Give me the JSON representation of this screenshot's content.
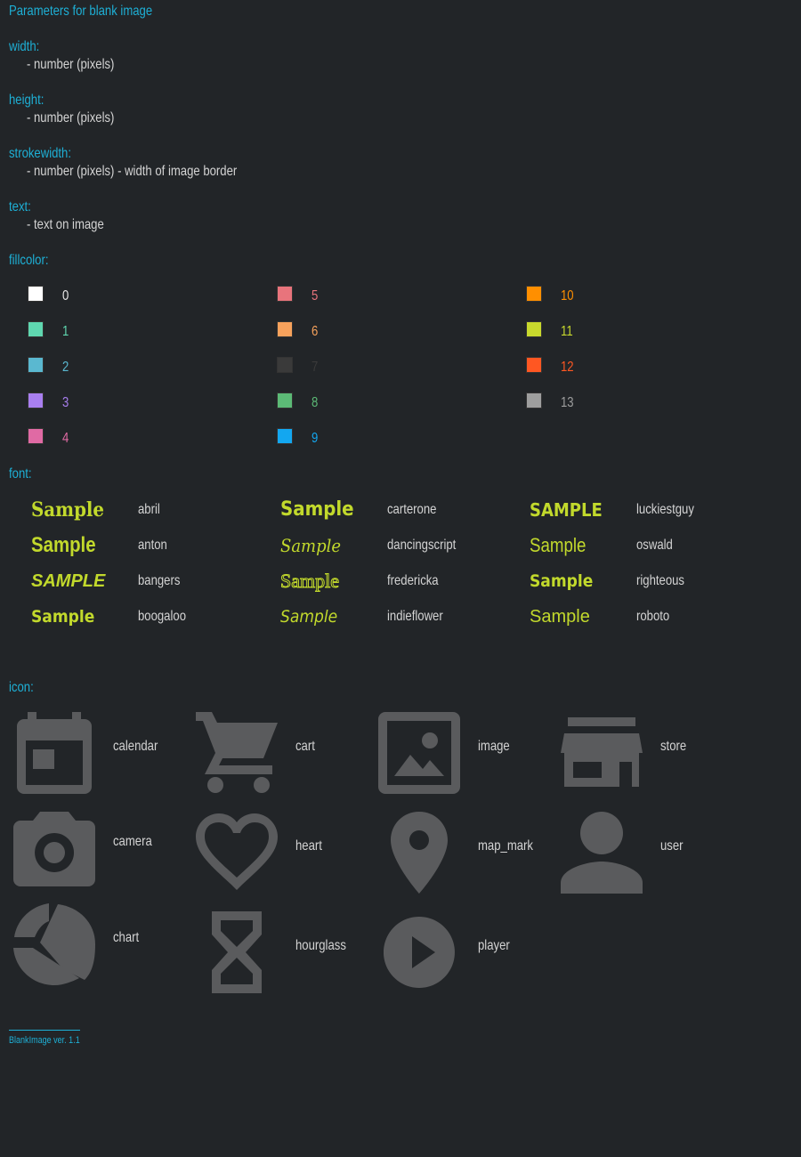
{
  "title": "Parameters for blank image",
  "params": [
    {
      "name": "width:",
      "desc": "- number (pixels)"
    },
    {
      "name": "height:",
      "desc": "- number (pixels)"
    },
    {
      "name": "strokewidth:",
      "desc": "- number (pixels) - width of image border"
    },
    {
      "name": "text:",
      "desc": "- text on image"
    }
  ],
  "fillcolor": {
    "label": "fillcolor:",
    "items": [
      {
        "num": "0",
        "color": "#ffffff"
      },
      {
        "num": "1",
        "color": "#5fd7b0"
      },
      {
        "num": "2",
        "color": "#5ab8d0"
      },
      {
        "num": "3",
        "color": "#a97ff0"
      },
      {
        "num": "4",
        "color": "#e06aa4"
      },
      {
        "num": "5",
        "color": "#e8747c"
      },
      {
        "num": "6",
        "color": "#f7a25c"
      },
      {
        "num": "7",
        "color": "#3a3a3a"
      },
      {
        "num": "8",
        "color": "#5cba76"
      },
      {
        "num": "9",
        "color": "#13a7f0"
      },
      {
        "num": "10",
        "color": "#ff8f00"
      },
      {
        "num": "11",
        "color": "#c8d92d"
      },
      {
        "num": "12",
        "color": "#ff5722"
      },
      {
        "num": "13",
        "color": "#9e9e9e"
      }
    ]
  },
  "font": {
    "label": "font:",
    "sample_text": "Sample",
    "items": [
      {
        "name": "abril"
      },
      {
        "name": "anton"
      },
      {
        "name": "bangers"
      },
      {
        "name": "boogaloo"
      },
      {
        "name": "carterone"
      },
      {
        "name": "dancingscript"
      },
      {
        "name": "fredericka"
      },
      {
        "name": "indieflower"
      },
      {
        "name": "luckiestguy"
      },
      {
        "name": "oswald"
      },
      {
        "name": "righteous"
      },
      {
        "name": "roboto"
      }
    ]
  },
  "icon": {
    "label": "icon:",
    "items": [
      {
        "name": "calendar",
        "icon": "calendar-icon"
      },
      {
        "name": "cart",
        "icon": "cart-icon"
      },
      {
        "name": "image",
        "icon": "image-icon"
      },
      {
        "name": "store",
        "icon": "store-icon"
      },
      {
        "name": "camera",
        "icon": "camera-icon"
      },
      {
        "name": "heart",
        "icon": "heart-icon"
      },
      {
        "name": "map_mark",
        "icon": "map-mark-icon"
      },
      {
        "name": "user",
        "icon": "user-icon"
      },
      {
        "name": "chart",
        "icon": "chart-icon"
      },
      {
        "name": "hourglass",
        "icon": "hourglass-icon"
      },
      {
        "name": "player",
        "icon": "player-icon"
      }
    ]
  },
  "footer": "BlankImage ver. 1.1"
}
